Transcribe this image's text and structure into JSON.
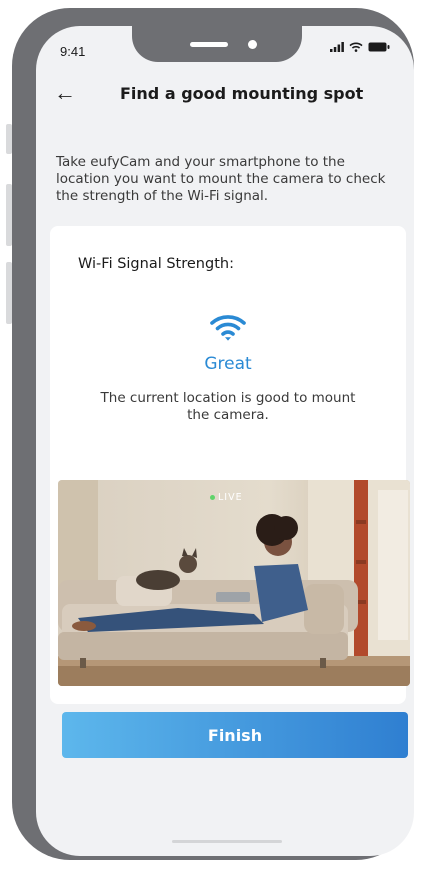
{
  "status_bar": {
    "time": "9:41",
    "icons": [
      "cellular-signal-icon",
      "wifi-icon",
      "battery-icon"
    ]
  },
  "header": {
    "back_icon": "back-arrow-icon",
    "title": "Find a good mounting spot"
  },
  "instructions": "Take eufyCam and your smartphone to the location you want to mount the camera to check the strength of the Wi-Fi signal.",
  "signal_card": {
    "heading": "Wi-Fi Signal Strength:",
    "signal_icon": "wifi-icon",
    "signal_level": "Great",
    "description": "The current location is good to mount the camera.",
    "preview_badge": "LIVE"
  },
  "finish_button": "Finish",
  "colors": {
    "accent": "#2a8ad4",
    "button_gradient_start": "#5db7ec",
    "button_gradient_end": "#2f7fd1",
    "phone_frame": "#6e6f73",
    "screen_background": "#f1f2f4",
    "live_dot": "#5fd36a"
  }
}
